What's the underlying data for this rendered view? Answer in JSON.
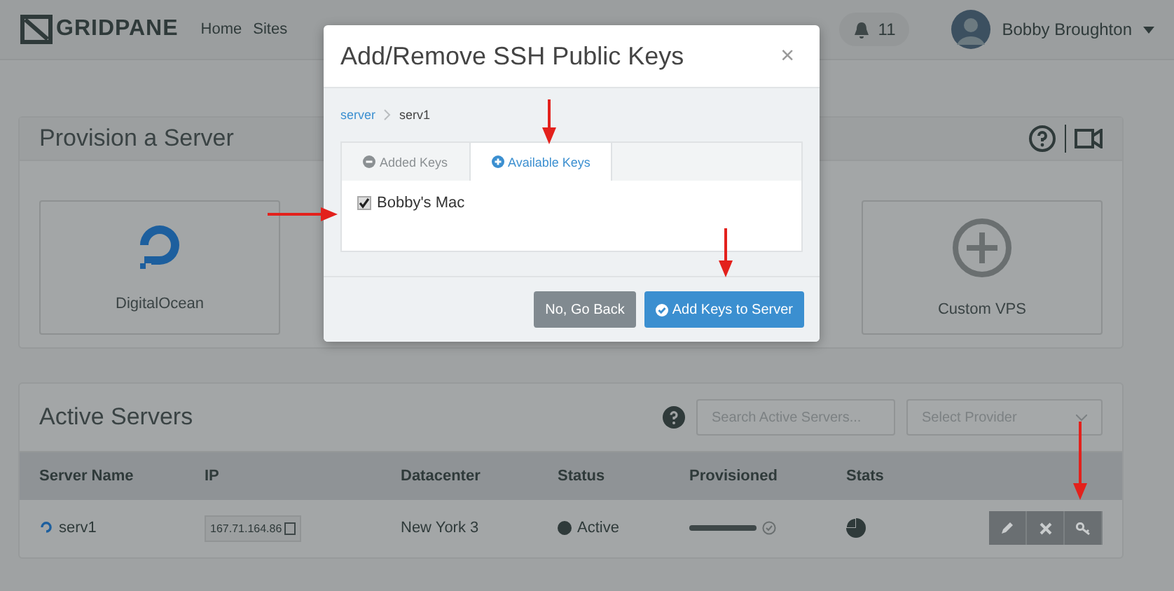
{
  "header": {
    "logo": "GRIDPANE",
    "nav": [
      "Home",
      "Sites"
    ],
    "notifications": "11",
    "user": "Bobby Broughton"
  },
  "provision": {
    "title": "Provision a Server",
    "tiles": [
      {
        "label": "DigitalOcean",
        "kind": "digitalocean"
      },
      {
        "label": "Custom VPS",
        "kind": "custom"
      }
    ]
  },
  "modal": {
    "title": "Add/Remove SSH Public Keys",
    "close": "×",
    "breadcrumb": [
      "server",
      "serv1"
    ],
    "tabs": [
      {
        "label": "Added Keys",
        "kind": "minus",
        "selected": false
      },
      {
        "label": "Available Keys",
        "kind": "plus",
        "selected": true
      }
    ],
    "keys": [
      {
        "label": "Bobby's Mac",
        "checked": true
      }
    ],
    "buttons": [
      {
        "label": "No, Go Back",
        "kind": "cancel"
      },
      {
        "label": "Add Keys to Server",
        "kind": "confirm"
      }
    ]
  },
  "servers": {
    "title": "Active Servers",
    "search": {
      "placeholder": "Search Active Servers..."
    },
    "provider": {
      "placeholder": "Select Provider"
    },
    "columns": [
      "Server Name",
      "IP",
      "Datacenter",
      "Status",
      "Provisioned",
      "Stats"
    ],
    "rows": [
      {
        "name": "serv1",
        "ip": "167.71.164.86",
        "datacenter": "New York 3",
        "status": "Active",
        "level": 1
      }
    ]
  }
}
